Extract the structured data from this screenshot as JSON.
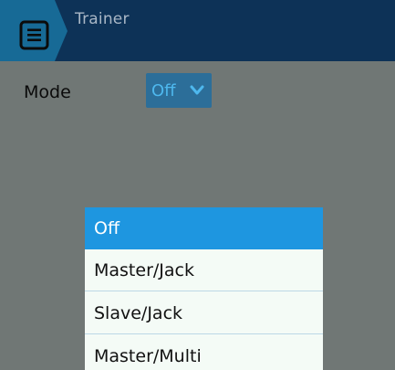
{
  "header": {
    "title": "Trainer",
    "menu_icon": "menu-icon"
  },
  "mode": {
    "label": "Mode",
    "selected_value": "Off",
    "chevron_icon": "chevron-down-icon"
  },
  "dropdown": {
    "options": [
      "Off",
      "Master/Jack",
      "Slave/Jack",
      "Master/Multi"
    ],
    "selected_index": 0
  },
  "colors": {
    "header_bg": "#0d3257",
    "tab_bg": "#176a96",
    "screen_bg": "#707775",
    "select_bg": "#2c6e99",
    "select_text": "#4eb8ee",
    "highlight": "#1e96e0"
  }
}
